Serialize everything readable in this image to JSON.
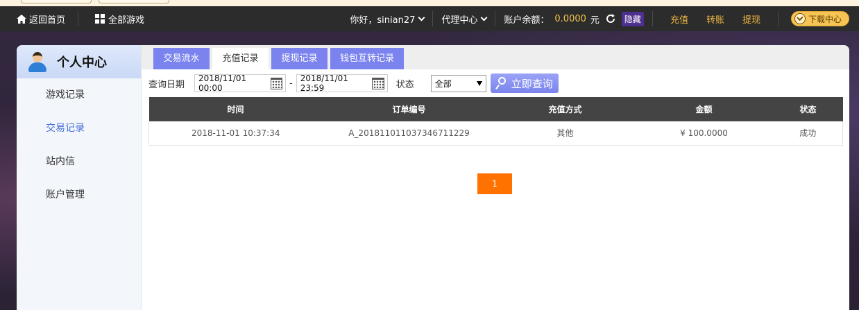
{
  "header": {
    "home_label": "返回首页",
    "games_label": "全部游戏",
    "greeting": "你好，sinian27",
    "agent_center": "代理中心",
    "balance_label": "账户余额：",
    "balance_amount": "0.0000",
    "balance_unit": "元",
    "hide_label": "隐藏",
    "recharge": "充值",
    "transfer": "转账",
    "withdraw": "提现",
    "download": "下载中心"
  },
  "sidebar": {
    "title": "个人中心",
    "items": [
      {
        "label": "游戏记录",
        "active": false
      },
      {
        "label": "交易记录",
        "active": true
      },
      {
        "label": "站内信",
        "active": false
      },
      {
        "label": "账户管理",
        "active": false
      }
    ]
  },
  "tabs": [
    {
      "label": "交易流水",
      "active": false
    },
    {
      "label": "充值记录",
      "active": true
    },
    {
      "label": "提现记录",
      "active": false
    },
    {
      "label": "钱包互转记录",
      "active": false
    }
  ],
  "filter": {
    "date_label": "查询日期",
    "start_date": "2018/11/01 00:00",
    "separator": "-",
    "end_date": "2018/11/01 23:59",
    "status_label": "状态",
    "status_value": "全部",
    "query_button": "立即查询"
  },
  "table": {
    "columns": [
      "时间",
      "订单编号",
      "充值方式",
      "金额",
      "状态"
    ],
    "rows": [
      [
        "2018-11-01 10:37:34",
        "A_201811011037346711229",
        "其他",
        "¥ 100.0000",
        "成功"
      ]
    ]
  },
  "pagination": {
    "current": "1"
  },
  "colors": {
    "accent": "#7b83ee",
    "gold": "#f5c74a",
    "page_active": "#ff7200",
    "table_header": "#444444"
  }
}
